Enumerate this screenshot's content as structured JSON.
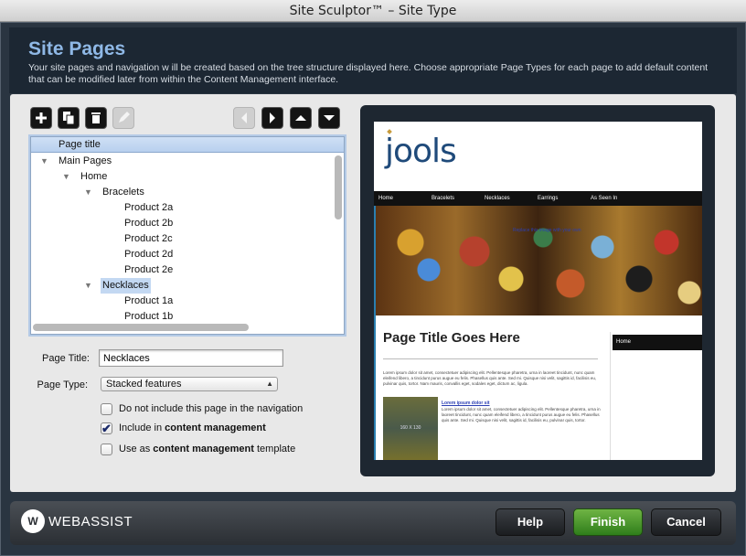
{
  "window": {
    "title": "Site Sculptor™ – Site Type"
  },
  "header": {
    "title": "Site Pages",
    "description": "Your site pages and navigation w ill be created based on the tree structure displayed here. Choose appropriate Page Types for each page to add default content that can be modified later from within the Content Management interface."
  },
  "toolbar": {
    "add_icon": "plus",
    "copy_icon": "copy",
    "delete_icon": "trash",
    "edit_icon": "pencil",
    "left_icon": "arrow-left",
    "right_icon": "arrow-right",
    "up_icon": "arrow-up",
    "down_icon": "arrow-down"
  },
  "tree": {
    "header": "Page title",
    "rows": [
      {
        "label": "Main Pages",
        "expanded": true
      },
      {
        "label": "Home",
        "expanded": true
      },
      {
        "label": "Bracelets",
        "expanded": true
      },
      {
        "label": "Product 2a"
      },
      {
        "label": "Product 2b"
      },
      {
        "label": "Product 2c"
      },
      {
        "label": "Product 2d"
      },
      {
        "label": "Product 2e"
      },
      {
        "label": "Necklaces",
        "expanded": true,
        "selected": true
      },
      {
        "label": "Product 1a"
      },
      {
        "label": "Product 1b"
      }
    ]
  },
  "form": {
    "page_title_label": "Page Title:",
    "page_title_value": "Necklaces",
    "page_type_label": "Page Type:",
    "page_type_value": "Stacked features",
    "check_nav": {
      "label": "Do not include this page in the navigation",
      "checked": false
    },
    "check_cm_prefix": "Include in ",
    "check_cm_bold": "content management",
    "check_cm_checked": true,
    "check_tpl_prefix": "Use as ",
    "check_tpl_bold": "content management",
    "check_tpl_suffix": " template",
    "check_tpl_checked": false
  },
  "preview": {
    "logo": "jools",
    "nav": [
      "Home",
      "Bracelets",
      "Necklaces",
      "Earrings",
      "As Seen In"
    ],
    "banner_link": "Replace this image with your own",
    "page_title": "Page Title Goes Here",
    "para1": "Lorem ipsum dolor sit amet, consectetuer adipiscing elit. Pellentesque pharetra, urna in laoreet tincidunt, nunc quam eleifend libero, a tincidunt purus augue eu felis. Phasellus quis ante. Sed mi. Quisque nisi velit, sagittis id, facilisis eu, pulvinar quis, tortor. Nam mauris, convallis eget, sodales eget, dictum ac, ligula.",
    "link": "Lorem ipsum dolor sit",
    "para2": "Lorem ipsum dolor sit amet, consectetuer adipiscing elit. Pellentesque pharetra, urna in laoreet tincidunt, nunc quam eleifend libero, a tincidunt purus augue eu felis. Phasellus quis ante. Sed mi. Quisque nisi velit, sagittis id, facilisis eu, pulvinar quis, tortor.",
    "img_label": "160 X 130",
    "side_head": "Home"
  },
  "footer": {
    "brand_mark": "W",
    "brand_name": "WEBASSIST",
    "help": "Help",
    "finish": "Finish",
    "cancel": "Cancel"
  }
}
